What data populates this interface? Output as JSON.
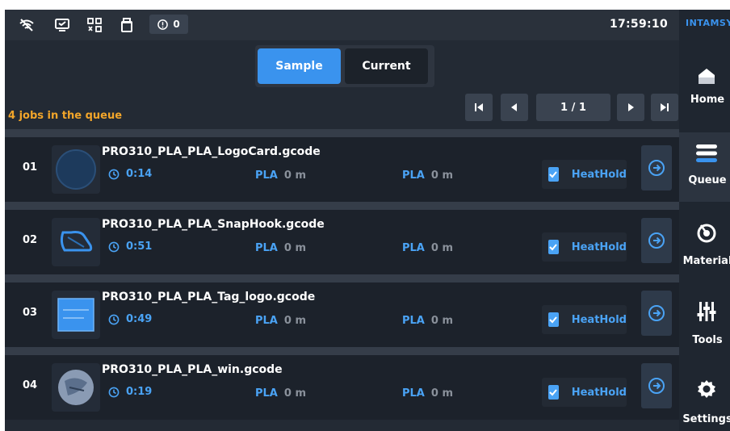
{
  "status": {
    "alert_count": "0",
    "time": "17:59:10"
  },
  "tabs": [
    {
      "label": "Sample",
      "active": true
    },
    {
      "label": "Current",
      "active": false
    }
  ],
  "queue": {
    "count_text": "4 jobs in the queue",
    "page_indicator": "1 / 1"
  },
  "jobs": [
    {
      "num": "01",
      "name": "PRO310_PLA_PLA_LogoCard.gcode",
      "time": "0:14",
      "mat1": "PLA",
      "len1": "0 m",
      "mat2": "PLA",
      "len2": "0 m",
      "heat_label": "HeatHold",
      "heat_checked": true
    },
    {
      "num": "02",
      "name": "PRO310_PLA_PLA_SnapHook.gcode",
      "time": "0:51",
      "mat1": "PLA",
      "len1": "0 m",
      "mat2": "PLA",
      "len2": "0 m",
      "heat_label": "HeatHold",
      "heat_checked": true
    },
    {
      "num": "03",
      "name": "PRO310_PLA_PLA_Tag_logo.gcode",
      "time": "0:49",
      "mat1": "PLA",
      "len1": "0 m",
      "mat2": "PLA",
      "len2": "0 m",
      "heat_label": "HeatHold",
      "heat_checked": true
    },
    {
      "num": "04",
      "name": "PRO310_PLA_PLA_win.gcode",
      "time": "0:19",
      "mat1": "PLA",
      "len1": "0 m",
      "mat2": "PLA",
      "len2": "0 m",
      "heat_label": "HeatHold",
      "heat_checked": true
    }
  ],
  "sidebar": {
    "logo": "INTAMSYS",
    "items": [
      {
        "label": "Home",
        "icon": "home-icon",
        "active": false
      },
      {
        "label": "Queue",
        "icon": "queue-icon",
        "active": true
      },
      {
        "label": "Material",
        "icon": "material-icon",
        "active": false
      },
      {
        "label": "Tools",
        "icon": "tools-icon",
        "active": false
      },
      {
        "label": "Settings",
        "icon": "settings-icon",
        "active": false
      }
    ]
  },
  "colors": {
    "accent": "#3a93ee",
    "warning": "#f2a52a",
    "background": "#1f2630"
  }
}
